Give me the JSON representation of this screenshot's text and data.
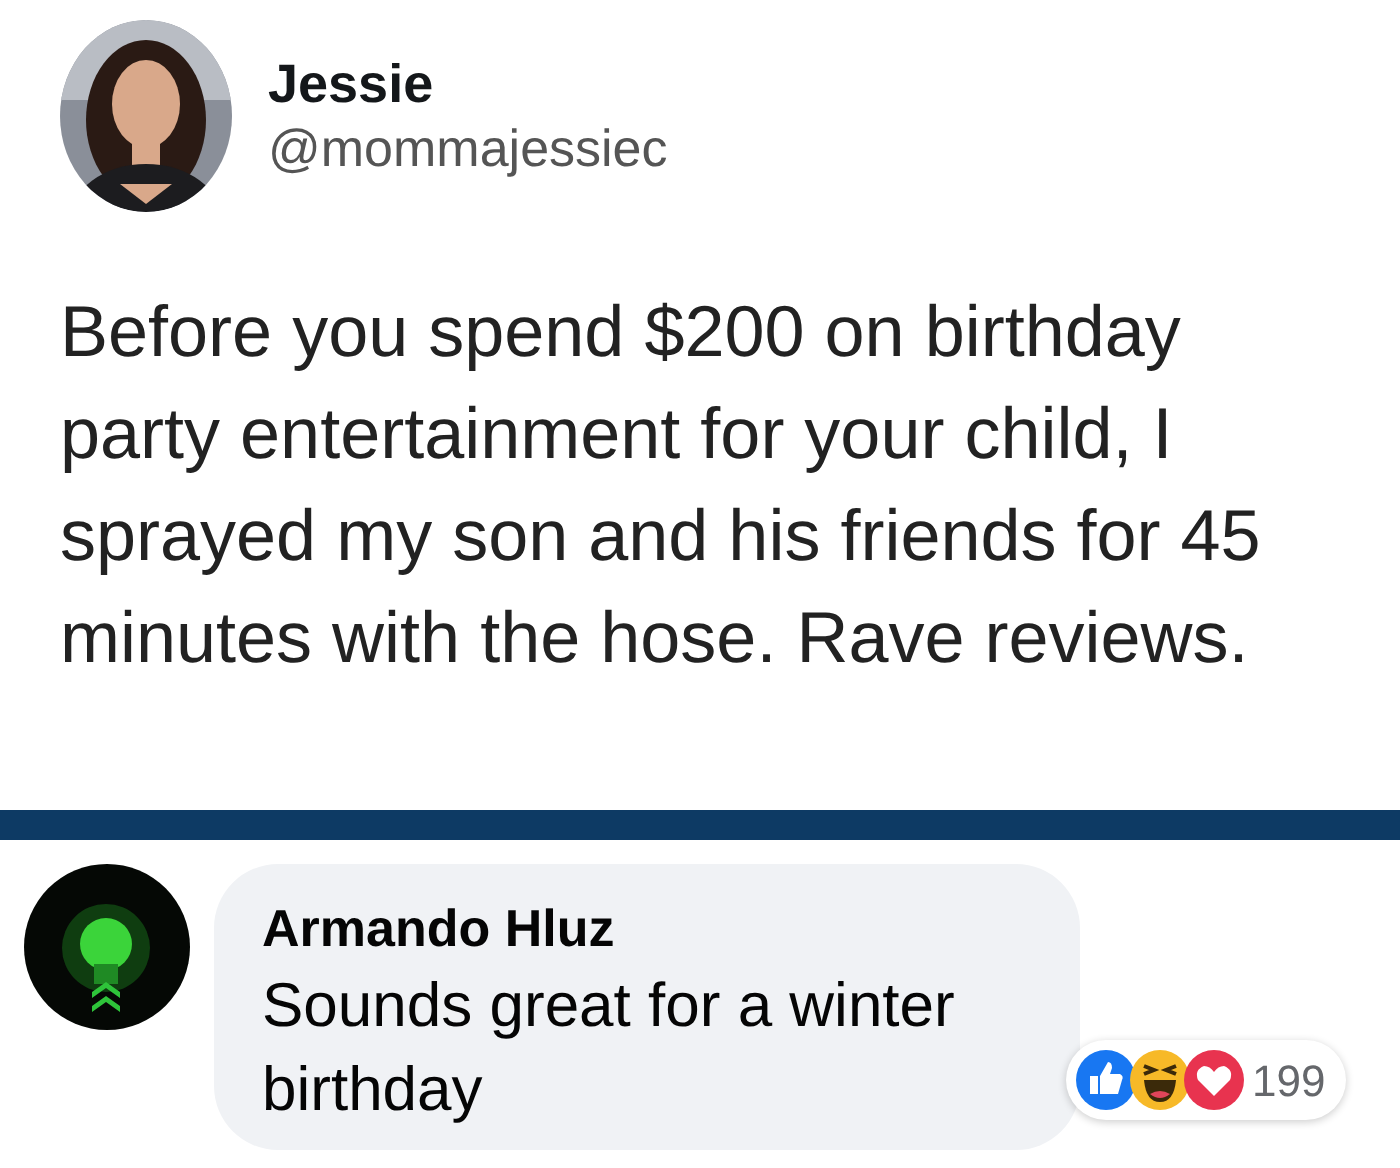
{
  "tweet": {
    "author": "Jessie",
    "handle": "@mommajessiec",
    "text": "Before you spend $200 on birthday party entertainment for your child, I sprayed my son and his friends for 45 minutes with the hose. Rave reviews."
  },
  "comment": {
    "author": "Armando Hluz",
    "text": "Sounds great for a winter birthday",
    "reactions": {
      "types": [
        {
          "kind": "like"
        },
        {
          "kind": "haha"
        },
        {
          "kind": "love"
        }
      ],
      "count": "199"
    }
  }
}
